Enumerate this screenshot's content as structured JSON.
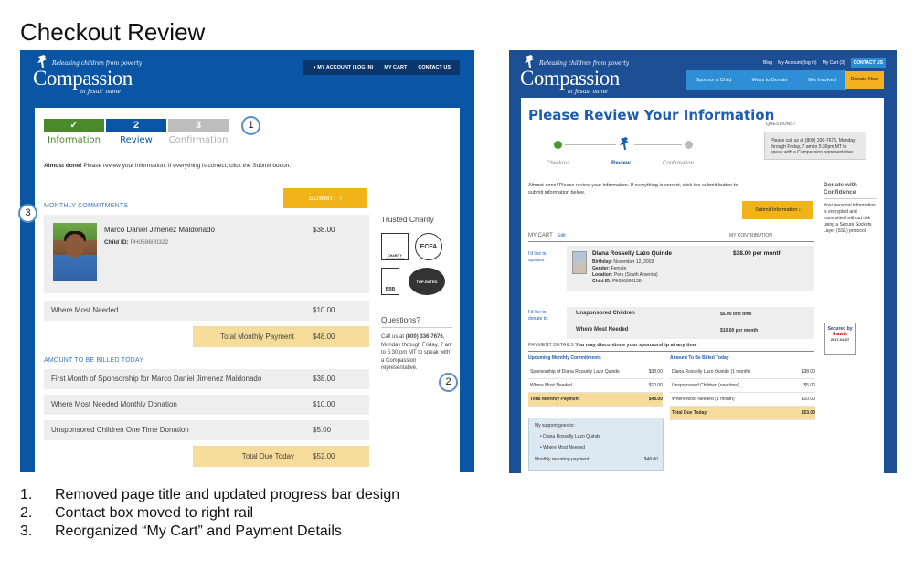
{
  "page_title": "Checkout Review",
  "brand": {
    "tagline": "Releasing children from poverty",
    "name": "Compassion",
    "sub": "in Jesus' name"
  },
  "left": {
    "topnav": [
      "MY ACCOUNT (LOG IN)",
      "MY CART",
      "CONTACT US"
    ],
    "steps": [
      {
        "mark": "✓",
        "label": "Information"
      },
      {
        "mark": "2",
        "label": "Review"
      },
      {
        "mark": "3",
        "label": "Confirmation"
      }
    ],
    "almost_bold": "Almost done!",
    "almost_rest": " Please review your information. If everything is correct, click the Submit button.",
    "submit": "SUBMIT ›",
    "monthly_title": "MONTHLY COMMITMENTS",
    "child": {
      "name": "Marco Daniel Jimenez Maldonado",
      "id_label": "Child ID:",
      "id_value": "PH059600322",
      "price": "$38.00"
    },
    "where_most": {
      "label": "Where Most Needed",
      "value": "$10.00"
    },
    "total_monthly": {
      "label": "Total Monthly Payment",
      "value": "$48.00"
    },
    "billed_title": "AMOUNT TO BE BILLED TODAY",
    "billed_rows": [
      {
        "label": "First Month of Sponsorship for Marco Daniel Jimenez Maldonado",
        "value": "$38.00"
      },
      {
        "label": "Where Most Needed Monthly Donation",
        "value": "$10.00"
      },
      {
        "label": "Unsponsored Children One Time Donation",
        "value": "$5.00"
      }
    ],
    "total_due": {
      "label": "Total Due Today",
      "value": "$52.00"
    },
    "trusted": "Trusted Charity",
    "badges": {
      "charity": "CHARITY NAVIGATOR",
      "ecfa": "ECFA",
      "bbb": "BBB",
      "top": "TOP-RATED"
    },
    "questions": "Questions?",
    "q_pre": "Call us at ",
    "q_phone": "(800) 336-7676",
    "q_post": ", Monday through Friday, 7 am to 5:30 pm MT to speak with a Compassion representative.",
    "callouts": [
      "1",
      "2",
      "3"
    ]
  },
  "right": {
    "util": [
      "Blog",
      "My Account (log in)",
      "My Cart (3)",
      "CONTACT US"
    ],
    "nav": [
      "Sponsor a Child",
      "Ways to Donate",
      "Get Involved"
    ],
    "donate": "Donate Now",
    "title": "Please Review Your Information",
    "questions_label": "QUESTIONS?",
    "questions_text": "Please call us at (800) 336-7676, Monday through Friday, 7 am to 5:30pm MT to speak with a Compassion representative.",
    "steps": [
      "Checkout",
      "Review",
      "Confirmation"
    ],
    "almost": "Almost done! Please review your information. If everything is correct, click the submit button to submit information below.",
    "submit": "Submit Information ›",
    "mycart": "MY CART",
    "edit": "Edit",
    "my_contribution": "MY CONTRIBUTION",
    "like_sponsor": "I'd like to sponsor:",
    "child": {
      "name": "Diana Rosselly Lazo Quinde",
      "birthday": "November 12, 2003",
      "gender": "Female",
      "location": "Peru (South America)",
      "id": "PE056800138",
      "price": "$38.00 per month",
      "l_birthday": "Birthday:",
      "l_gender": "Gender:",
      "l_location": "Location:",
      "l_id": "Child ID:"
    },
    "like_donate": "I'd like to donate to:",
    "donations": [
      {
        "label": "Unsponsored Children",
        "value": "$5.00 one time"
      },
      {
        "label": "Where Most Needed",
        "value": "$10.00 per month"
      }
    ],
    "paydet_title": "PAYMENT DETAILS",
    "paydet_note": "You may discontinue your sponsorship at any time",
    "upcoming_title": "Upcoming Monthly Commitments",
    "upcoming": [
      {
        "label": "Sponsorship of Diana Rosselly Lazo Quinde",
        "value": "$38.00"
      },
      {
        "label": "Where Most Needed",
        "value": "$10.00"
      }
    ],
    "upcoming_total": {
      "label": "Total Monthly Payment",
      "value": "$48.00"
    },
    "billed_title": "Amount To Be Billed Today",
    "billed": [
      {
        "label": "Diana Rosselly Lazo Quinde (1 month)",
        "value": "$38.00"
      },
      {
        "label": "Unsponsored Children (one time)",
        "value": "$5.00"
      },
      {
        "label": "Where Most Needed (1 month)",
        "value": "$10.00"
      }
    ],
    "billed_total": {
      "label": "Total Due Today",
      "value": "$53.00"
    },
    "support_title": "My support goes to:",
    "support_items": [
      "Diana Rosselly Lazo Quinde",
      "Where Most Needed"
    ],
    "support_recurring": {
      "label": "Monthly recurring payment:",
      "value": "$48.00"
    },
    "rail_title": "Donate with Confidence",
    "rail_text": "Your personal information is encrypted and transmitted without risk using a Secure Sockets Layer (SSL) protocol.",
    "secured": "Secured by",
    "secured_brand": "thawte",
    "secured_date": "2017-04-07"
  },
  "notes": [
    {
      "num": "1.",
      "text": "Removed page title and updated progress bar design"
    },
    {
      "num": "2.",
      "text": "Contact box moved to right rail"
    },
    {
      "num": "3.",
      "text": "Reorganized “My Cart” and Payment Details"
    }
  ]
}
